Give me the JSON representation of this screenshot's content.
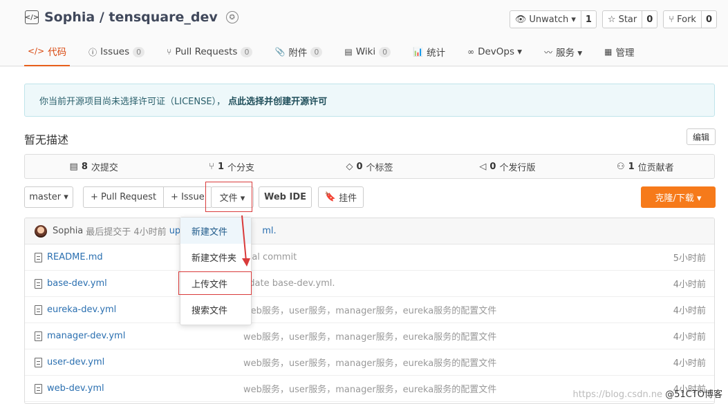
{
  "repo": {
    "title": "Sophia / tensquare_dev",
    "actions": [
      {
        "label": "Unwatch ▾",
        "count": "1"
      },
      {
        "label": "Star",
        "count": "0"
      },
      {
        "label": "Fork",
        "count": "0"
      }
    ]
  },
  "tabs": [
    {
      "icon": "</>",
      "label": "代码",
      "count": ""
    },
    {
      "icon": "ⓘ",
      "label": "Issues",
      "count": "0"
    },
    {
      "icon": "⑂",
      "label": "Pull Requests",
      "count": "0"
    },
    {
      "icon": "📎",
      "label": "附件",
      "count": "0"
    },
    {
      "icon": "▤",
      "label": "Wiki",
      "count": "0"
    },
    {
      "icon": "📊",
      "label": "统计",
      "count": ""
    },
    {
      "icon": "∞",
      "label": "DevOps ▾",
      "count": ""
    },
    {
      "icon": "〰",
      "label": "服务 ▾",
      "count": ""
    },
    {
      "icon": "▦",
      "label": "管理",
      "count": ""
    }
  ],
  "license": {
    "text": "你当前开源项目尚未选择许可证（LICENSE），",
    "link": "点此选择并创建开源许可"
  },
  "description": "暂无描述",
  "edit_label": "编辑",
  "stats": [
    {
      "num": "8",
      "label": "次提交"
    },
    {
      "num": "1",
      "label": "个分支"
    },
    {
      "num": "0",
      "label": "个标签"
    },
    {
      "num": "0",
      "label": "个发行版"
    },
    {
      "num": "1",
      "label": "位贡献者"
    }
  ],
  "toolbar": {
    "branch": "master ▾",
    "pull_request": "+ Pull Request",
    "issue": "+ Issue",
    "file": "文件 ▾",
    "web_ide": "Web IDE",
    "widget": "挂件",
    "clone": "克隆/下载 ▾"
  },
  "commit": {
    "author": "Sophia",
    "prefix": "最后提交于 4小时前",
    "message": "up",
    "message_tail": "ml."
  },
  "files": [
    {
      "name": "README.md",
      "msg": "itial commit",
      "time": "5小时前"
    },
    {
      "name": "base-dev.yml",
      "msg": "pdate base-dev.yml.",
      "time": "4小时前"
    },
    {
      "name": "eureka-dev.yml",
      "msg": "web服务，user服务，manager服务，eureka服务的配置文件",
      "time": "4小时前"
    },
    {
      "name": "manager-dev.yml",
      "msg": "web服务，user服务，manager服务，eureka服务的配置文件",
      "time": "4小时前"
    },
    {
      "name": "user-dev.yml",
      "msg": "web服务，user服务，manager服务，eureka服务的配置文件",
      "time": "4小时前"
    },
    {
      "name": "web-dev.yml",
      "msg": "web服务，user服务，manager服务，eureka服务的配置文件",
      "time": "4小时前"
    }
  ],
  "dropdown": [
    "新建文件",
    "新建文件夹",
    "上传文件",
    "搜索文件"
  ],
  "watermark": {
    "url": "https://blog.csdn.ne",
    "brand": "@51CTO博客"
  }
}
